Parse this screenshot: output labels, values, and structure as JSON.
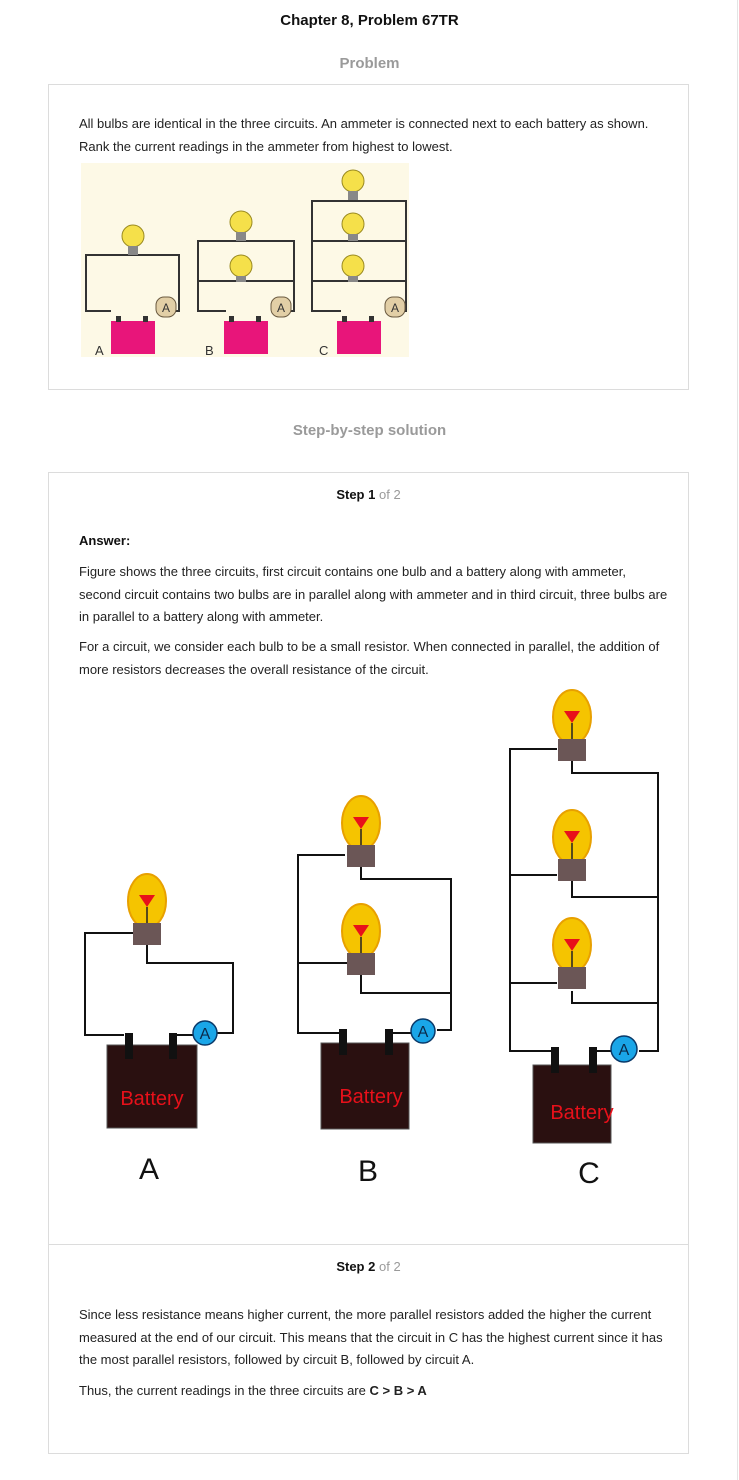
{
  "header": {
    "title": "Chapter 8, Problem 67TR"
  },
  "problem": {
    "heading": "Problem",
    "text": "All bulbs are identical in the three circuits. An ammeter is connected next to each battery as shown. Rank the current readings in the ammeter from highest to lowest.",
    "figure_labels": [
      "A",
      "B",
      "C"
    ],
    "meter_label": "A"
  },
  "solution": {
    "heading": "Step-by-step solution",
    "steps": [
      {
        "label": "Step",
        "number": "1",
        "of": "of 2",
        "answer_label": "Answer:",
        "paragraphs": [
          "Figure shows the three circuits, first circuit contains one bulb and a battery along with ammeter, second circuit contains two bulbs are in parallel along with ammeter and in third circuit, three bulbs are in parallel to a battery along with ammeter.",
          "For a circuit, we consider each bulb to be a small resistor. When connected in parallel, the addition of more resistors decreases the overall resistance of the circuit."
        ],
        "figure": {
          "battery_label": "Battery",
          "meter_label": "A",
          "circuit_labels": [
            "A",
            "B",
            "C"
          ]
        }
      },
      {
        "label": "Step",
        "number": "2",
        "of": "of 2",
        "paragraphs": [
          "Since less resistance means higher current, the more parallel resistors added the higher the current measured at the end of our circuit. This means that the circuit in C has the highest current since it has the most parallel resistors, followed by circuit B, followed by circuit A."
        ],
        "conclusion_prefix": "Thus, the current readings in the three circuits are ",
        "conclusion_ranking": "C > B > A"
      }
    ]
  },
  "colors": {
    "battery_small": "#e8157a",
    "battery_large": "#2a1010",
    "bulb": "#f5c400",
    "ammeter": "#1aa6e8",
    "figure_bg": "#fdf9e6"
  }
}
